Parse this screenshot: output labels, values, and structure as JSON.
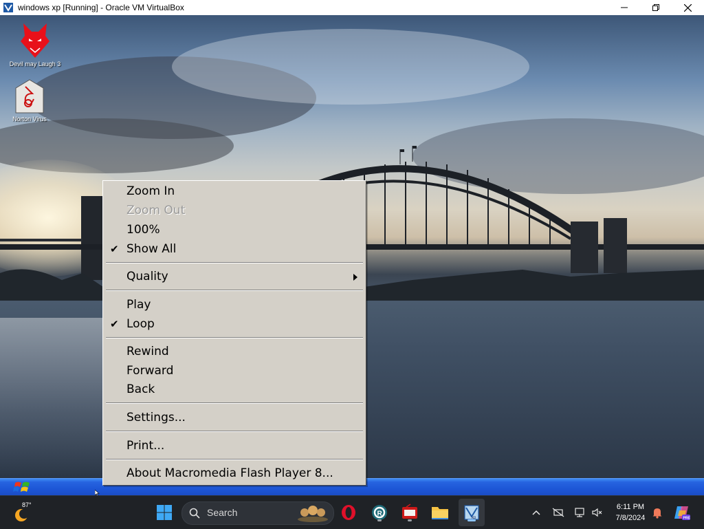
{
  "window": {
    "title": "windows xp [Running] - Oracle VM VirtualBox",
    "app_icon": "virtualbox-icon",
    "controls": [
      "minimize-icon",
      "maximize-icon",
      "close-icon"
    ]
  },
  "desktop": {
    "wallpaper": "Sydney Harbour Bridge at dusk",
    "icons": [
      {
        "label": "Devil may Laugh 3",
        "icon": "devil-face-icon",
        "color": "#e8101a"
      },
      {
        "label": "Norton Virus",
        "icon": "norton-virus-icon",
        "color": "#cc1111"
      }
    ]
  },
  "context_menu": {
    "items": [
      {
        "label": "Zoom In",
        "checked": false,
        "disabled": false
      },
      {
        "label": "Zoom Out",
        "checked": false,
        "disabled": true
      },
      {
        "label": "100%",
        "checked": false,
        "disabled": false
      },
      {
        "label": "Show All",
        "checked": true,
        "disabled": false
      },
      {
        "label": "Quality",
        "submenu": true
      },
      {
        "label": "Play",
        "checked": false
      },
      {
        "label": "Loop",
        "checked": true
      },
      {
        "label": "Rewind"
      },
      {
        "label": "Forward"
      },
      {
        "label": "Back"
      },
      {
        "label": "Settings..."
      },
      {
        "label": "Print..."
      },
      {
        "label": "About Macromedia Flash Player 8..."
      }
    ],
    "check_glyph": "✔"
  },
  "xp_taskbar": {
    "start_icon": "windows-xp-flag-icon",
    "color": "#2663e0"
  },
  "host_taskbar": {
    "weather": {
      "temp": "87°",
      "icon": "weather-sun-icon"
    },
    "search": {
      "placeholder": "Search"
    },
    "pinned": [
      "windows-start-icon",
      "opera-icon",
      "app-r-icon",
      "radio-app-icon",
      "file-explorer-icon",
      "virtualbox-xp-icon"
    ],
    "tray_icons": [
      "chevron-up-icon",
      "network-off-icon",
      "display-icon",
      "volume-muted-icon",
      "notification-bell-icon",
      "copilot-icon"
    ],
    "clock": {
      "time": "6:11 PM",
      "date": "7/8/2024"
    },
    "accent_bell": "#f07a5a"
  }
}
